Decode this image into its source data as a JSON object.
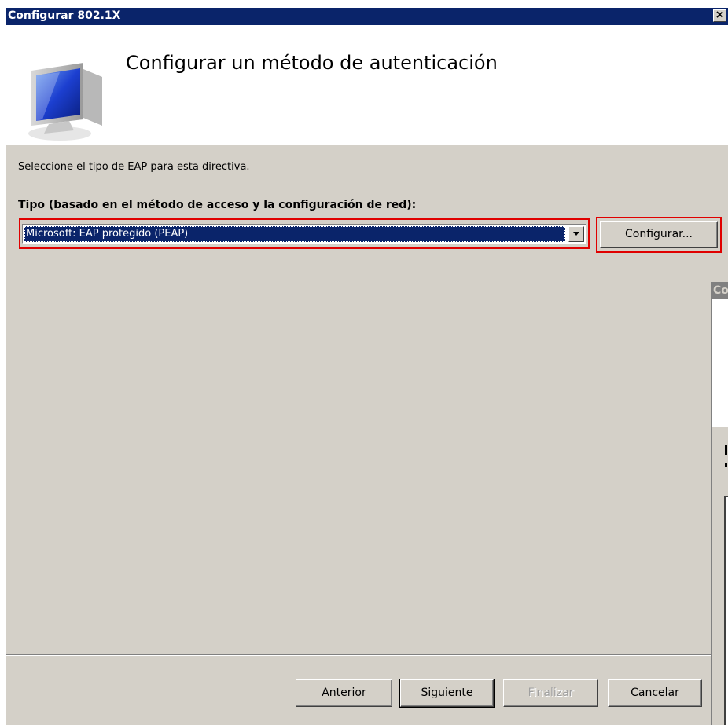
{
  "window": {
    "title": "Configurar 802.1X",
    "close_glyph": "×"
  },
  "header": {
    "title": "Configurar un método de autenticación",
    "icon": "computer-monitor-icon"
  },
  "body": {
    "instruction": "Seleccione el tipo de EAP para esta directiva.",
    "type_label": "Tipo (basado en el método de acceso y la configuración de red):",
    "eap_select": {
      "selected": "Microsoft: EAP protegido (PEAP)"
    },
    "configure_label": "Configurar..."
  },
  "footer": {
    "back_label": "Anterior",
    "next_label": "Siguiente",
    "finish_label": "Finalizar",
    "cancel_label": "Cancelar"
  },
  "background_window": {
    "title_fragment": "Co"
  },
  "colors": {
    "titlebar": "#0a246a",
    "dialog": "#d4d0c8",
    "highlight": "#e00000",
    "selection": "#0a246a"
  }
}
